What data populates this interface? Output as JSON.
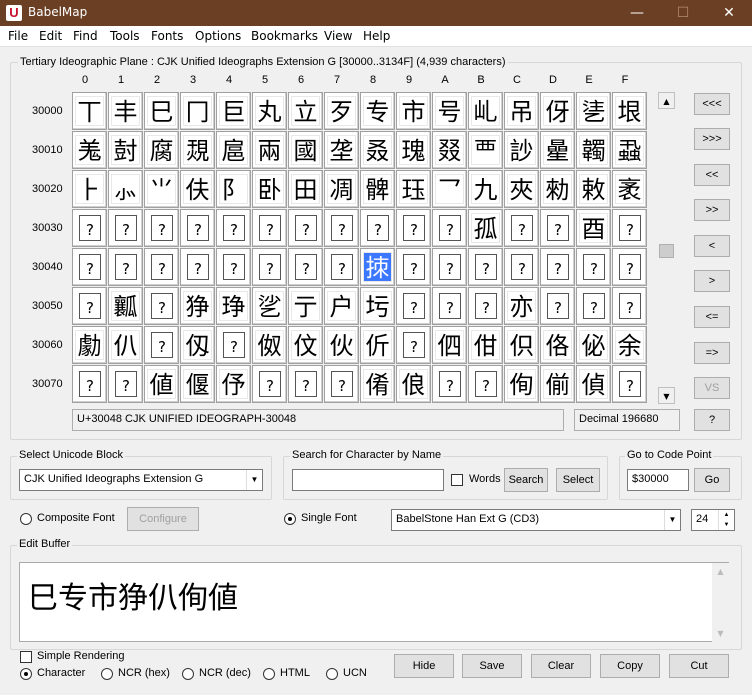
{
  "window": {
    "app_letter": "U",
    "title": "BabelMap",
    "minimize": "—",
    "maximize": "☐",
    "close": "✕"
  },
  "menu": [
    "File",
    "Edit",
    "Find",
    "Tools",
    "Fonts",
    "Options",
    "Bookmarks",
    "View",
    "Help"
  ],
  "plane_label": "Tertiary Ideographic Plane : CJK Unified Ideographs Extension G [30000..3134F] (4,939 characters)",
  "columns": [
    "0",
    "1",
    "2",
    "3",
    "4",
    "5",
    "6",
    "7",
    "8",
    "9",
    "A",
    "B",
    "C",
    "D",
    "E",
    "F"
  ],
  "rows": [
    {
      "label": "30000",
      "chars": [
        "丅",
        "丰",
        "巳",
        "冂",
        "巨",
        "丸",
        "立",
        "歹",
        "专",
        "市",
        "号",
        "乢",
        "吊",
        "伢",
        "乼",
        "垠"
      ]
    },
    {
      "label": "30010",
      "chars": [
        "羗",
        "尌",
        "腐",
        "覝",
        "扈",
        "兩",
        "國",
        "垄",
        "叒",
        "瑰",
        "叕",
        "覀",
        "訬",
        "曐",
        "韣",
        "蝨"
      ]
    },
    {
      "label": "30020",
      "chars": [
        "⺊",
        "⺗",
        "⺌",
        "伕",
        "阝",
        "卧",
        "田",
        "凋",
        "髀",
        "珏",
        "⺂",
        "九",
        "夾",
        "勑",
        "敕",
        "袤"
      ]
    },
    {
      "label": "30030",
      "chars": [
        "?",
        "?",
        "?",
        "?",
        "?",
        "?",
        "?",
        "?",
        "?",
        "?",
        "?",
        "孤",
        "?",
        "?",
        "酉",
        "?"
      ]
    },
    {
      "label": "30040",
      "chars": [
        "?",
        "?",
        "?",
        "?",
        "?",
        "?",
        "?",
        "?",
        "拺",
        "?",
        "?",
        "?",
        "?",
        "?",
        "?",
        "?"
      ]
    },
    {
      "label": "30050",
      "chars": [
        "?",
        "瓤",
        "?",
        "狰",
        "琤",
        "乷",
        "亍",
        "户",
        "圬",
        "?",
        "?",
        "?",
        "亦",
        "?",
        "?",
        "?"
      ]
    },
    {
      "label": "30060",
      "chars": [
        "勮",
        "仈",
        "?",
        "仭",
        "?",
        "伮",
        "伩",
        "伙",
        "伒",
        "?",
        "伵",
        "佄",
        "伿",
        "佫",
        "佖",
        "余"
      ]
    },
    {
      "label": "30070",
      "chars": [
        "?",
        "?",
        "値",
        "偃",
        "伃",
        "?",
        "?",
        "?",
        "倄",
        "俍",
        "?",
        "?",
        "侚",
        "偂",
        "偵",
        "?"
      ]
    }
  ],
  "selected": {
    "row": 4,
    "col": 8
  },
  "nav_buttons": [
    "<<<",
    ">>>",
    "<<",
    ">>",
    "<",
    ">",
    "<=",
    "=>",
    "VS"
  ],
  "help_button": "?",
  "status": {
    "char_name": "U+30048 CJK UNIFIED IDEOGRAPH-30048",
    "decimal": "Decimal 196680"
  },
  "unicode_block": {
    "label": "Select Unicode Block",
    "value": "CJK Unified Ideographs Extension G"
  },
  "search": {
    "label": "Search for Character by Name",
    "value": "",
    "words_label": "Words",
    "search_button": "Search",
    "select_button": "Select"
  },
  "goto": {
    "label": "Go to Code Point",
    "value": "$30000",
    "button": "Go"
  },
  "font": {
    "composite_label": "Composite Font",
    "configure_button": "Configure",
    "single_label": "Single Font",
    "font_name": "BabelStone Han Ext G (CD3)",
    "size": "24"
  },
  "edit_buffer": {
    "label": "Edit Buffer",
    "text": "巳专市狰仈侚値"
  },
  "bottom": {
    "simple_rendering": "Simple Rendering",
    "modes": [
      "Character",
      "NCR (hex)",
      "NCR (dec)",
      "HTML",
      "UCN"
    ],
    "buttons": [
      "Hide",
      "Save",
      "Clear",
      "Copy",
      "Cut"
    ]
  },
  "colors": {
    "titlebar": "#6b3f24",
    "selection": "#3b78ff"
  }
}
